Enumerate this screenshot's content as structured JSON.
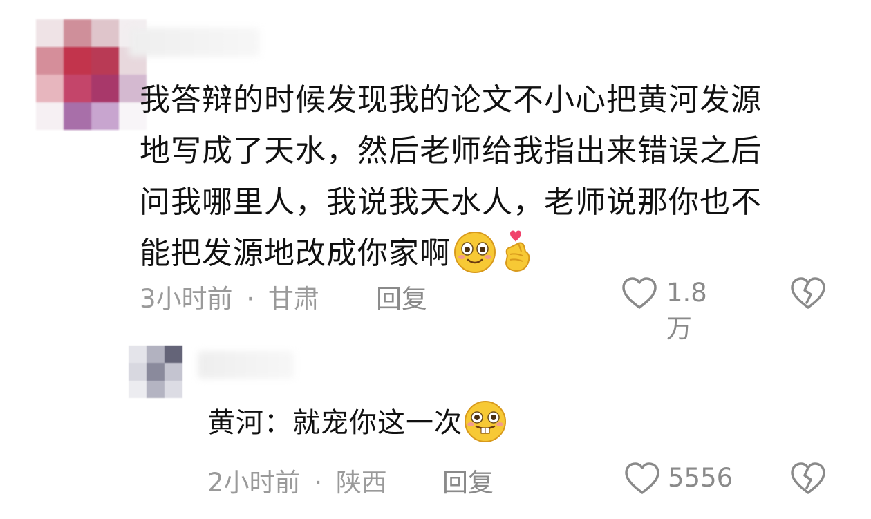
{
  "comments": [
    {
      "text_lines": [
        "我答辩的时候发现我的论文不小心把黄河发源",
        "地写成了天水，然后老师给我指出来错误之后",
        "问我哪里人，我说我天水人，老师说那你也不",
        "能把发源地改成你家啊"
      ],
      "emojis": [
        "smile-emoji",
        "finger-heart-emoji"
      ],
      "time": "3小时前",
      "location": "甘肃",
      "reply_label": "回复",
      "like_count": "1.8万"
    },
    {
      "text": "黄河：就宠你这一次",
      "emojis": [
        "buck-teeth-emoji"
      ],
      "time": "2小时前",
      "location": "陕西",
      "reply_label": "回复",
      "like_count": "5556"
    }
  ],
  "meta_separator": "·",
  "colors": {
    "text": "#111111",
    "meta": "#9a9a9a",
    "emoji_yellow": "#f7c935",
    "heart_pink": "#f0436b"
  }
}
